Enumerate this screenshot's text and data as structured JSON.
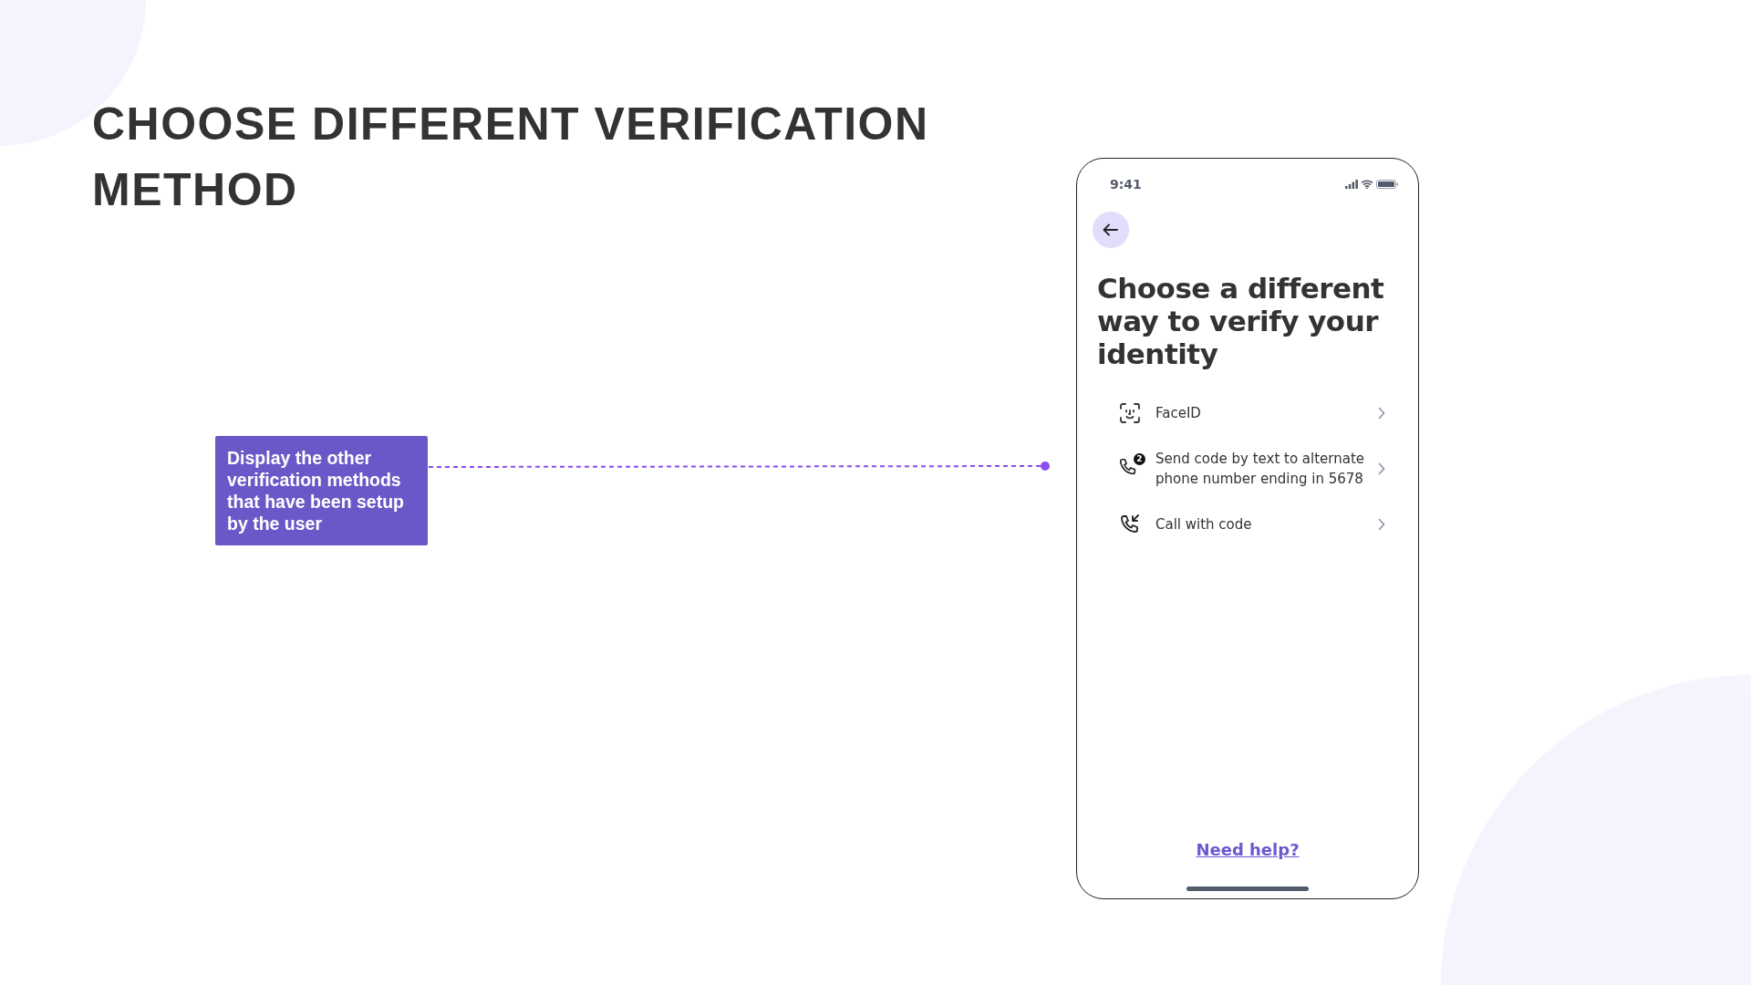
{
  "page_title": "CHOOSE DIFFERENT VERIFICATION METHOD",
  "annotation": {
    "text": "Display the other verification methods that have been setup by the user"
  },
  "phone": {
    "status_bar": {
      "time": "9:41"
    },
    "heading": "Choose a different way to verify your identity",
    "options": [
      {
        "kind": "face",
        "label": "FaceID"
      },
      {
        "kind": "text",
        "label": "Send code by text to alternate phone number ending in 5678",
        "badge": "2"
      },
      {
        "kind": "call",
        "label": "Call with code"
      }
    ],
    "help_link": "Need help?"
  }
}
